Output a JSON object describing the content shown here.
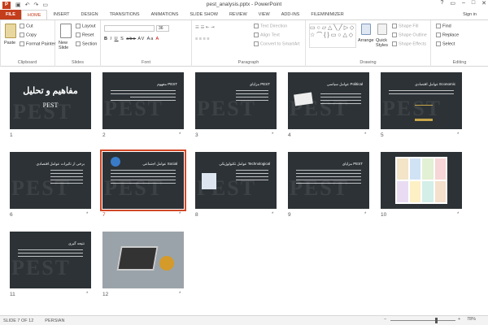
{
  "window": {
    "title": "pest_analysis.pptx - PowerPoint",
    "signin": "Sign in",
    "controls": [
      "?",
      "▭",
      "–",
      "□",
      "✕"
    ]
  },
  "qat": {
    "icons": [
      "save-icon",
      "undo-icon",
      "redo-icon",
      "present-icon"
    ],
    "glyphs": [
      "▣",
      "↶",
      "↷",
      "▭"
    ]
  },
  "tabs": [
    "FILE",
    "HOME",
    "INSERT",
    "DESIGN",
    "TRANSITIONS",
    "ANIMATIONS",
    "SLIDE SHOW",
    "REVIEW",
    "VIEW",
    "ADD-INS",
    "FILEminimizer"
  ],
  "active_tab": "HOME",
  "ribbon": {
    "clipboard": {
      "label": "Clipboard",
      "paste": "Paste",
      "cut": "Cut",
      "copy": "Copy",
      "format_painter": "Format Painter"
    },
    "slides": {
      "label": "Slides",
      "new_slide": "New Slide",
      "layout": "Layout",
      "reset": "Reset",
      "section": "Section"
    },
    "font": {
      "label": "Font",
      "font_name": "",
      "font_size": "36",
      "buttons": [
        "B",
        "I",
        "U",
        "S",
        "abc",
        "AV",
        "Aa",
        "A"
      ]
    },
    "paragraph": {
      "label": "Paragraph",
      "text_direction": "Text Direction",
      "align_text": "Align Text",
      "convert_smartart": "Convert to SmartArt"
    },
    "drawing": {
      "label": "Drawing",
      "arrange": "Arrange",
      "quick_styles": "Quick Styles",
      "shape_fill": "Shape Fill",
      "shape_outline": "Shape Outline",
      "shape_effects": "Shape Effects"
    },
    "editing": {
      "label": "Editing",
      "find": "Find",
      "replace": "Replace",
      "select": "Select"
    }
  },
  "slides": [
    {
      "num": "1",
      "title": "مفاهیم و تحلیل",
      "subtitle": "PEST",
      "star": ""
    },
    {
      "num": "2",
      "title": "مفهوم PEST",
      "star": "*"
    },
    {
      "num": "3",
      "title": "مزایای PEST",
      "star": "*"
    },
    {
      "num": "4",
      "title": "عوامل سیاسی Political",
      "star": "*"
    },
    {
      "num": "5",
      "title": "عوامل اقتصادی Economic",
      "star": "*"
    },
    {
      "num": "6",
      "title": "برخی از تاثیرات عوامل اقتصادی",
      "star": "*"
    },
    {
      "num": "7",
      "title": "عوامل اجتماعی Social",
      "star": "*"
    },
    {
      "num": "8",
      "title": "عوامل تکنولوژیکی Technological",
      "star": "*"
    },
    {
      "num": "9",
      "title": "مزایای PEST",
      "star": "*"
    },
    {
      "num": "10",
      "title": "",
      "star": "*"
    },
    {
      "num": "11",
      "title": "نتیجه گیری",
      "star": "*"
    },
    {
      "num": "12",
      "title": "",
      "star": "*"
    }
  ],
  "selected_slide": "7",
  "status": {
    "slide_of": "SLIDE 7 OF 12",
    "language": "PERSIAN",
    "zoom": "78%",
    "minus": "−",
    "plus": "+"
  }
}
